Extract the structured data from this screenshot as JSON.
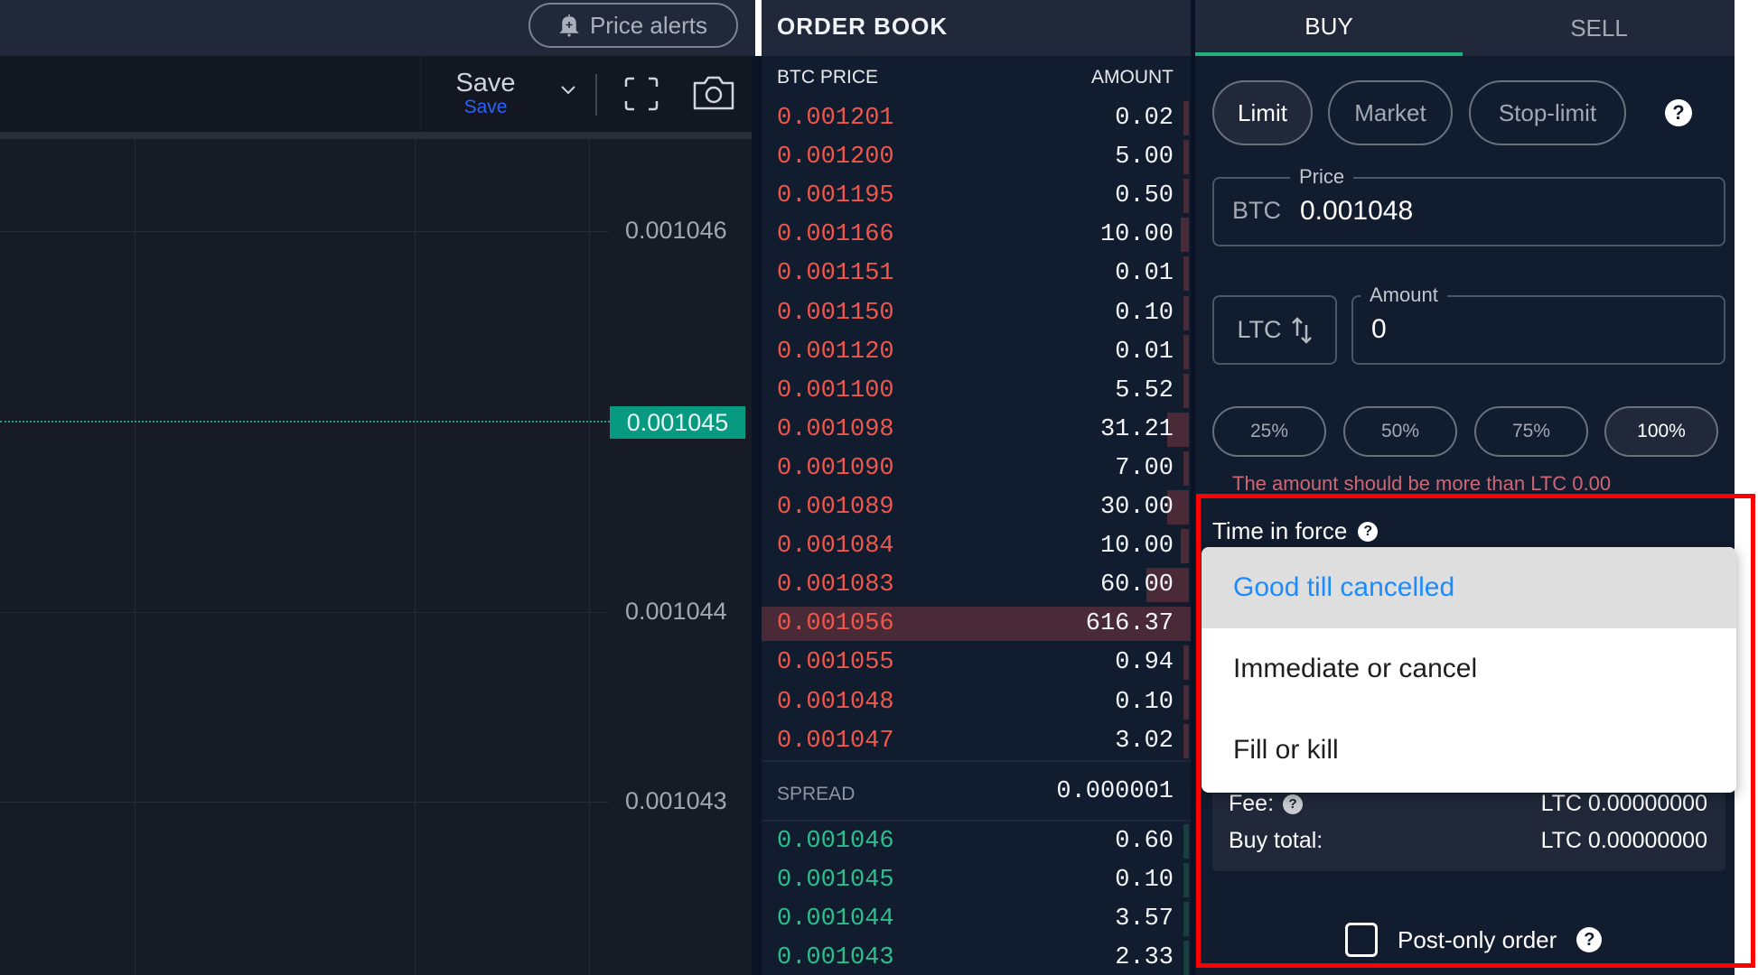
{
  "chart": {
    "price_alerts_label": "Price alerts",
    "save_label": "Save",
    "save_sublabel": "Save",
    "axis_labels": [
      "0.001046",
      "0.001044",
      "0.001043"
    ],
    "last_price": "0.001045",
    "colors": {
      "last_price_tag": "#089981",
      "save_accent": "#2962ff"
    }
  },
  "orderbook": {
    "title": "ORDER BOOK",
    "col_price": "BTC PRICE",
    "col_amount": "AMOUNT",
    "asks": [
      {
        "price": "0.001201",
        "amount": "0.02",
        "depth": 0.005
      },
      {
        "price": "0.001200",
        "amount": "5.00",
        "depth": 0.005
      },
      {
        "price": "0.001195",
        "amount": "0.50",
        "depth": 0.005
      },
      {
        "price": "0.001166",
        "amount": "10.00",
        "depth": 0.02
      },
      {
        "price": "0.001151",
        "amount": "0.01",
        "depth": 0.005
      },
      {
        "price": "0.001150",
        "amount": "0.10",
        "depth": 0.005
      },
      {
        "price": "0.001120",
        "amount": "0.01",
        "depth": 0.005
      },
      {
        "price": "0.001100",
        "amount": "5.52",
        "depth": 0.01
      },
      {
        "price": "0.001098",
        "amount": "31.21",
        "depth": 0.05
      },
      {
        "price": "0.001090",
        "amount": "7.00",
        "depth": 0.01
      },
      {
        "price": "0.001089",
        "amount": "30.00",
        "depth": 0.05
      },
      {
        "price": "0.001084",
        "amount": "10.00",
        "depth": 0.02
      },
      {
        "price": "0.001083",
        "amount": "60.00",
        "depth": 0.1
      },
      {
        "price": "0.001056",
        "amount": "616.37",
        "depth": 1.0
      },
      {
        "price": "0.001055",
        "amount": "0.94",
        "depth": 0.005
      },
      {
        "price": "0.001048",
        "amount": "0.10",
        "depth": 0.005
      },
      {
        "price": "0.001047",
        "amount": "3.02",
        "depth": 0.005
      }
    ],
    "spread_label": "SPREAD",
    "spread_value": "0.000001",
    "bids": [
      {
        "price": "0.001046",
        "amount": "0.60",
        "depth": 0.005
      },
      {
        "price": "0.001045",
        "amount": "0.10",
        "depth": 0.005
      },
      {
        "price": "0.001044",
        "amount": "3.57",
        "depth": 0.005
      },
      {
        "price": "0.001043",
        "amount": "2.33",
        "depth": 0.005
      }
    ],
    "colors": {
      "ask": "#f0574a",
      "bid": "#2bbf8c"
    }
  },
  "trade": {
    "tabs": [
      {
        "label": "BUY",
        "active": true
      },
      {
        "label": "SELL",
        "active": false
      }
    ],
    "order_types": [
      {
        "label": "Limit",
        "active": true
      },
      {
        "label": "Market",
        "active": false
      },
      {
        "label": "Stop-limit",
        "active": false
      }
    ],
    "price_legend": "Price",
    "price_currency": "BTC",
    "price_value": "0.001048",
    "amount_currency": "LTC",
    "amount_legend": "Amount",
    "amount_value": "0",
    "percent_buttons": [
      {
        "label": "25%",
        "active": false
      },
      {
        "label": "50%",
        "active": false
      },
      {
        "label": "75%",
        "active": false
      },
      {
        "label": "100%",
        "active": true
      }
    ],
    "amount_error": "The amount should be more than LTC 0.00",
    "time_in_force_label": "Time in force",
    "time_in_force_options": [
      {
        "label": "Good till cancelled",
        "selected": true
      },
      {
        "label": "Immediate or cancel",
        "selected": false
      },
      {
        "label": "Fill or kill",
        "selected": false
      }
    ],
    "fee_label": "Fee:",
    "fee_value": "LTC 0.00000000",
    "buy_total_label": "Buy total:",
    "buy_total_value": "LTC 0.00000000",
    "post_only_label": "Post-only order",
    "post_only_checked": false,
    "help_glyph": "?",
    "colors": {
      "buy_tab_underline": "#21b07f",
      "error": "#d06674",
      "selected_option": "#1a8cff"
    }
  }
}
